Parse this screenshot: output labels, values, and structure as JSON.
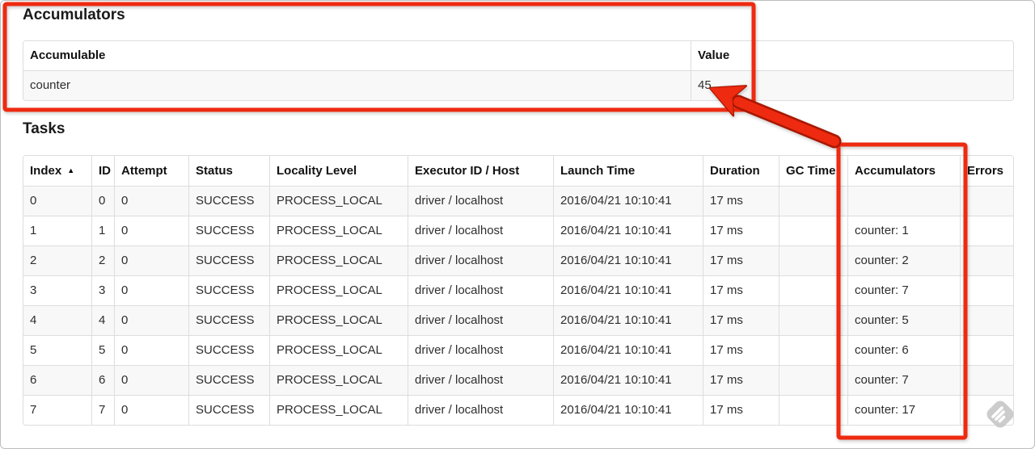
{
  "accumulators_section": {
    "title": "Accumulators",
    "table": {
      "headers": [
        "Accumulable",
        "Value"
      ],
      "rows": [
        {
          "accumulable": "counter",
          "value": "45"
        }
      ]
    }
  },
  "tasks_section": {
    "title": "Tasks",
    "table": {
      "headers": [
        "Index",
        "ID",
        "Attempt",
        "Status",
        "Locality Level",
        "Executor ID / Host",
        "Launch Time",
        "Duration",
        "GC Time",
        "Accumulators",
        "Errors"
      ],
      "sort_column": "Index",
      "sort_indicator": "▲",
      "rows": [
        {
          "index": "0",
          "id": "0",
          "attempt": "0",
          "status": "SUCCESS",
          "locality": "PROCESS_LOCAL",
          "executor": "driver / localhost",
          "launch_time": "2016/04/21 10:10:41",
          "duration": "17 ms",
          "gc_time": "",
          "accumulators": "",
          "errors": ""
        },
        {
          "index": "1",
          "id": "1",
          "attempt": "0",
          "status": "SUCCESS",
          "locality": "PROCESS_LOCAL",
          "executor": "driver / localhost",
          "launch_time": "2016/04/21 10:10:41",
          "duration": "17 ms",
          "gc_time": "",
          "accumulators": "counter: 1",
          "errors": ""
        },
        {
          "index": "2",
          "id": "2",
          "attempt": "0",
          "status": "SUCCESS",
          "locality": "PROCESS_LOCAL",
          "executor": "driver / localhost",
          "launch_time": "2016/04/21 10:10:41",
          "duration": "17 ms",
          "gc_time": "",
          "accumulators": "counter: 2",
          "errors": ""
        },
        {
          "index": "3",
          "id": "3",
          "attempt": "0",
          "status": "SUCCESS",
          "locality": "PROCESS_LOCAL",
          "executor": "driver / localhost",
          "launch_time": "2016/04/21 10:10:41",
          "duration": "17 ms",
          "gc_time": "",
          "accumulators": "counter: 7",
          "errors": ""
        },
        {
          "index": "4",
          "id": "4",
          "attempt": "0",
          "status": "SUCCESS",
          "locality": "PROCESS_LOCAL",
          "executor": "driver / localhost",
          "launch_time": "2016/04/21 10:10:41",
          "duration": "17 ms",
          "gc_time": "",
          "accumulators": "counter: 5",
          "errors": ""
        },
        {
          "index": "5",
          "id": "5",
          "attempt": "0",
          "status": "SUCCESS",
          "locality": "PROCESS_LOCAL",
          "executor": "driver / localhost",
          "launch_time": "2016/04/21 10:10:41",
          "duration": "17 ms",
          "gc_time": "",
          "accumulators": "counter: 6",
          "errors": ""
        },
        {
          "index": "6",
          "id": "6",
          "attempt": "0",
          "status": "SUCCESS",
          "locality": "PROCESS_LOCAL",
          "executor": "driver / localhost",
          "launch_time": "2016/04/21 10:10:41",
          "duration": "17 ms",
          "gc_time": "",
          "accumulators": "counter: 7",
          "errors": ""
        },
        {
          "index": "7",
          "id": "7",
          "attempt": "0",
          "status": "SUCCESS",
          "locality": "PROCESS_LOCAL",
          "executor": "driver / localhost",
          "launch_time": "2016/04/21 10:10:41",
          "duration": "17 ms",
          "gc_time": "",
          "accumulators": "counter: 17",
          "errors": ""
        }
      ]
    }
  },
  "annotations": {
    "color": "#ee2a10",
    "outline_color": "#a81800",
    "boxes": [
      "accumulators-summary-highlight",
      "accumulators-column-highlight"
    ],
    "arrow": "from-accumulators-column-to-value-45"
  },
  "icons": {
    "sort_ascending": "▲",
    "watermark": "skitch-diamond-badge",
    "watermark_color": "#c6c6c6"
  }
}
